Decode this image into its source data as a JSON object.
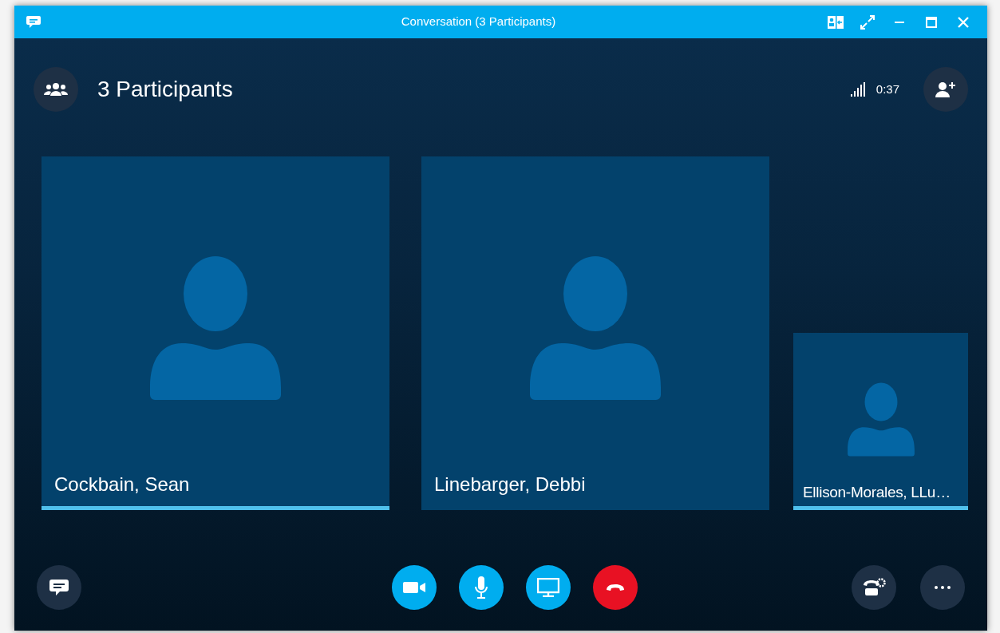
{
  "window": {
    "title": "Conversation (3 Participants)"
  },
  "header": {
    "title": "3 Participants",
    "timer": "0:37"
  },
  "participants": [
    {
      "name": "Cockbain, Sean",
      "speaking": true,
      "expanded": true
    },
    {
      "name": "Linebarger, Debbi",
      "speaking": false,
      "expanded": true
    },
    {
      "name": "Ellison-Morales, LLu…",
      "speaking": true,
      "expanded": false
    }
  ]
}
